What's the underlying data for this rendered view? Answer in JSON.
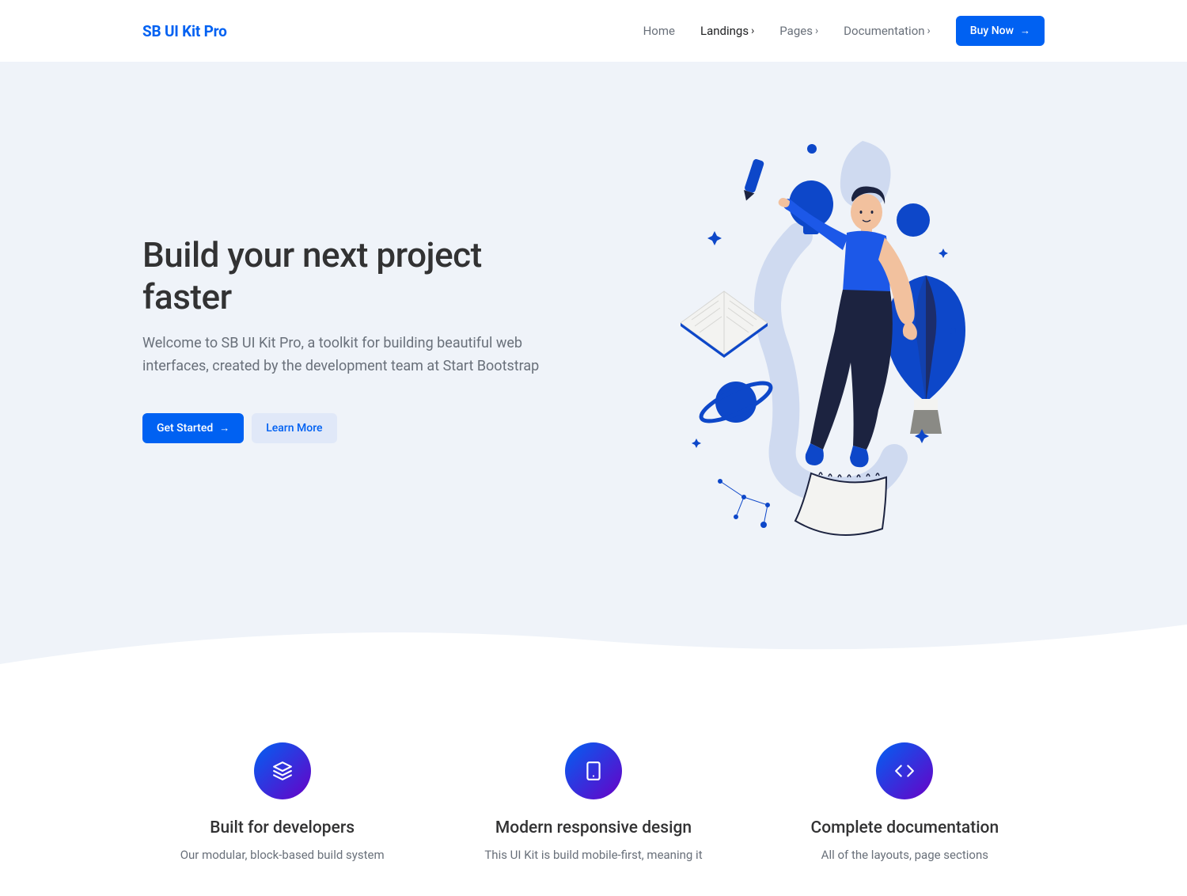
{
  "brand": "SB UI Kit Pro",
  "nav": {
    "home": "Home",
    "landings": "Landings",
    "pages": "Pages",
    "documentation": "Documentation",
    "buy": "Buy Now"
  },
  "hero": {
    "title": "Build your next project faster",
    "subtitle": "Welcome to SB UI Kit Pro, a toolkit for building beautiful web interfaces, created by the development team at Start Bootstrap",
    "primary_btn": "Get Started",
    "secondary_btn": "Learn More"
  },
  "features": [
    {
      "title": "Built for developers",
      "desc": "Our modular, block-based build system"
    },
    {
      "title": "Modern responsive design",
      "desc": "This UI Kit is build mobile-first, meaning it"
    },
    {
      "title": "Complete documentation",
      "desc": "All of the layouts, page sections"
    }
  ]
}
